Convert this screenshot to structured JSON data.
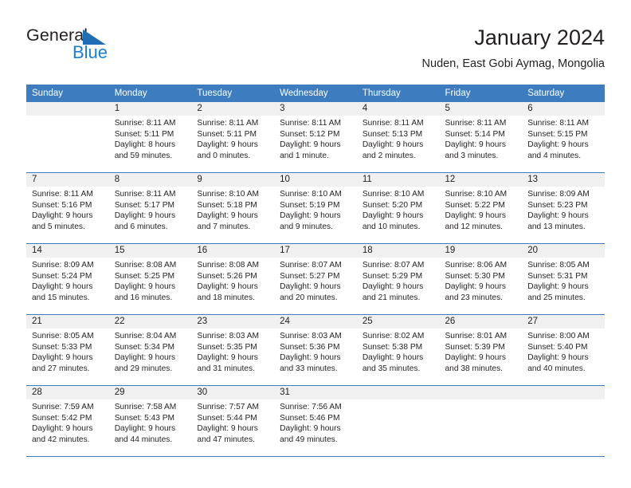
{
  "logo": {
    "word_dark": "General",
    "word_blue": "Blue",
    "triangle_color": "#1f6db5",
    "blue_color": "#1b7fd4"
  },
  "header": {
    "title": "January 2024",
    "subtitle": "Nuden, East Gobi Aymag, Mongolia"
  },
  "theme": {
    "header_row_bg": "#3c7cbf",
    "daynum_bg": "#f0f0f0",
    "grid_line": "#3c7cbf",
    "text": "#231f20"
  },
  "calendar": {
    "weekday_headers": [
      "Sunday",
      "Monday",
      "Tuesday",
      "Wednesday",
      "Thursday",
      "Friday",
      "Saturday"
    ],
    "weeks": [
      [
        {
          "day": "",
          "sunrise": "",
          "sunset": "",
          "daylight": ""
        },
        {
          "day": "1",
          "sunrise": "Sunrise: 8:11 AM",
          "sunset": "Sunset: 5:11 PM",
          "daylight": "Daylight: 8 hours and 59 minutes."
        },
        {
          "day": "2",
          "sunrise": "Sunrise: 8:11 AM",
          "sunset": "Sunset: 5:11 PM",
          "daylight": "Daylight: 9 hours and 0 minutes."
        },
        {
          "day": "3",
          "sunrise": "Sunrise: 8:11 AM",
          "sunset": "Sunset: 5:12 PM",
          "daylight": "Daylight: 9 hours and 1 minute."
        },
        {
          "day": "4",
          "sunrise": "Sunrise: 8:11 AM",
          "sunset": "Sunset: 5:13 PM",
          "daylight": "Daylight: 9 hours and 2 minutes."
        },
        {
          "day": "5",
          "sunrise": "Sunrise: 8:11 AM",
          "sunset": "Sunset: 5:14 PM",
          "daylight": "Daylight: 9 hours and 3 minutes."
        },
        {
          "day": "6",
          "sunrise": "Sunrise: 8:11 AM",
          "sunset": "Sunset: 5:15 PM",
          "daylight": "Daylight: 9 hours and 4 minutes."
        }
      ],
      [
        {
          "day": "7",
          "sunrise": "Sunrise: 8:11 AM",
          "sunset": "Sunset: 5:16 PM",
          "daylight": "Daylight: 9 hours and 5 minutes."
        },
        {
          "day": "8",
          "sunrise": "Sunrise: 8:11 AM",
          "sunset": "Sunset: 5:17 PM",
          "daylight": "Daylight: 9 hours and 6 minutes."
        },
        {
          "day": "9",
          "sunrise": "Sunrise: 8:10 AM",
          "sunset": "Sunset: 5:18 PM",
          "daylight": "Daylight: 9 hours and 7 minutes."
        },
        {
          "day": "10",
          "sunrise": "Sunrise: 8:10 AM",
          "sunset": "Sunset: 5:19 PM",
          "daylight": "Daylight: 9 hours and 9 minutes."
        },
        {
          "day": "11",
          "sunrise": "Sunrise: 8:10 AM",
          "sunset": "Sunset: 5:20 PM",
          "daylight": "Daylight: 9 hours and 10 minutes."
        },
        {
          "day": "12",
          "sunrise": "Sunrise: 8:10 AM",
          "sunset": "Sunset: 5:22 PM",
          "daylight": "Daylight: 9 hours and 12 minutes."
        },
        {
          "day": "13",
          "sunrise": "Sunrise: 8:09 AM",
          "sunset": "Sunset: 5:23 PM",
          "daylight": "Daylight: 9 hours and 13 minutes."
        }
      ],
      [
        {
          "day": "14",
          "sunrise": "Sunrise: 8:09 AM",
          "sunset": "Sunset: 5:24 PM",
          "daylight": "Daylight: 9 hours and 15 minutes."
        },
        {
          "day": "15",
          "sunrise": "Sunrise: 8:08 AM",
          "sunset": "Sunset: 5:25 PM",
          "daylight": "Daylight: 9 hours and 16 minutes."
        },
        {
          "day": "16",
          "sunrise": "Sunrise: 8:08 AM",
          "sunset": "Sunset: 5:26 PM",
          "daylight": "Daylight: 9 hours and 18 minutes."
        },
        {
          "day": "17",
          "sunrise": "Sunrise: 8:07 AM",
          "sunset": "Sunset: 5:27 PM",
          "daylight": "Daylight: 9 hours and 20 minutes."
        },
        {
          "day": "18",
          "sunrise": "Sunrise: 8:07 AM",
          "sunset": "Sunset: 5:29 PM",
          "daylight": "Daylight: 9 hours and 21 minutes."
        },
        {
          "day": "19",
          "sunrise": "Sunrise: 8:06 AM",
          "sunset": "Sunset: 5:30 PM",
          "daylight": "Daylight: 9 hours and 23 minutes."
        },
        {
          "day": "20",
          "sunrise": "Sunrise: 8:05 AM",
          "sunset": "Sunset: 5:31 PM",
          "daylight": "Daylight: 9 hours and 25 minutes."
        }
      ],
      [
        {
          "day": "21",
          "sunrise": "Sunrise: 8:05 AM",
          "sunset": "Sunset: 5:33 PM",
          "daylight": "Daylight: 9 hours and 27 minutes."
        },
        {
          "day": "22",
          "sunrise": "Sunrise: 8:04 AM",
          "sunset": "Sunset: 5:34 PM",
          "daylight": "Daylight: 9 hours and 29 minutes."
        },
        {
          "day": "23",
          "sunrise": "Sunrise: 8:03 AM",
          "sunset": "Sunset: 5:35 PM",
          "daylight": "Daylight: 9 hours and 31 minutes."
        },
        {
          "day": "24",
          "sunrise": "Sunrise: 8:03 AM",
          "sunset": "Sunset: 5:36 PM",
          "daylight": "Daylight: 9 hours and 33 minutes."
        },
        {
          "day": "25",
          "sunrise": "Sunrise: 8:02 AM",
          "sunset": "Sunset: 5:38 PM",
          "daylight": "Daylight: 9 hours and 35 minutes."
        },
        {
          "day": "26",
          "sunrise": "Sunrise: 8:01 AM",
          "sunset": "Sunset: 5:39 PM",
          "daylight": "Daylight: 9 hours and 38 minutes."
        },
        {
          "day": "27",
          "sunrise": "Sunrise: 8:00 AM",
          "sunset": "Sunset: 5:40 PM",
          "daylight": "Daylight: 9 hours and 40 minutes."
        }
      ],
      [
        {
          "day": "28",
          "sunrise": "Sunrise: 7:59 AM",
          "sunset": "Sunset: 5:42 PM",
          "daylight": "Daylight: 9 hours and 42 minutes."
        },
        {
          "day": "29",
          "sunrise": "Sunrise: 7:58 AM",
          "sunset": "Sunset: 5:43 PM",
          "daylight": "Daylight: 9 hours and 44 minutes."
        },
        {
          "day": "30",
          "sunrise": "Sunrise: 7:57 AM",
          "sunset": "Sunset: 5:44 PM",
          "daylight": "Daylight: 9 hours and 47 minutes."
        },
        {
          "day": "31",
          "sunrise": "Sunrise: 7:56 AM",
          "sunset": "Sunset: 5:46 PM",
          "daylight": "Daylight: 9 hours and 49 minutes."
        },
        {
          "day": "",
          "sunrise": "",
          "sunset": "",
          "daylight": ""
        },
        {
          "day": "",
          "sunrise": "",
          "sunset": "",
          "daylight": ""
        },
        {
          "day": "",
          "sunrise": "",
          "sunset": "",
          "daylight": ""
        }
      ]
    ]
  }
}
